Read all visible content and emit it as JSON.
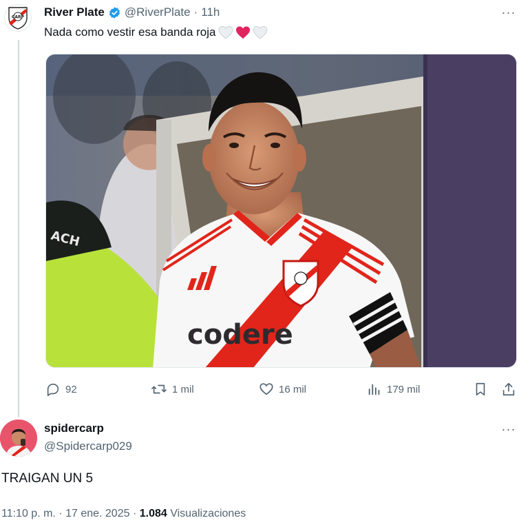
{
  "tweet": {
    "author_name": "River Plate",
    "author_handle": "@RiverPlate",
    "separator": "·",
    "time": "11h",
    "text": "Nada como vestir esa banda roja",
    "more_label": "···",
    "media": {
      "sponsor_text": "codere",
      "armband_text": "ACH"
    },
    "stats": {
      "replies": "92",
      "reposts": "1 mil",
      "likes": "16 mil",
      "views": "179 mil"
    }
  },
  "reply": {
    "author_name": "spidercarp",
    "author_handle": "@Spidercarp029",
    "more_label": "···",
    "text": "TRAIGAN UN 5",
    "timestamp": "11:10 p. m. · 17 ene. 2025",
    "separator": "·",
    "views_count": "1.084",
    "views_label": "Visualizaciones"
  },
  "colors": {
    "accent": "#1d9bf0",
    "river_red": "#e1251b",
    "secondary_text": "#536471"
  }
}
